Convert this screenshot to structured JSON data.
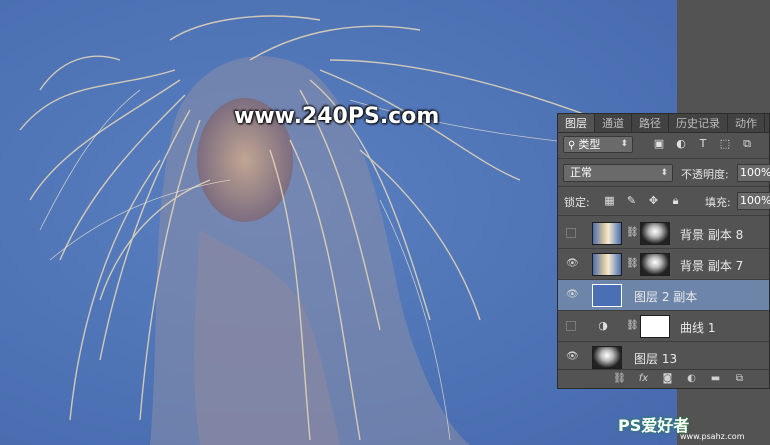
{
  "watermark": "www.240PS.com",
  "panel": {
    "tabs": [
      "图层",
      "通道",
      "路径",
      "历史记录",
      "动作"
    ],
    "filter": {
      "search_icon": "search-icon",
      "label": "类型"
    },
    "filter_icons": [
      "image-filter-icon",
      "adjustment-filter-icon",
      "type-filter-icon",
      "shape-filter-icon",
      "smart-object-filter-icon"
    ],
    "blend_mode": "正常",
    "opacity_label": "不透明度:",
    "opacity_value": "100%",
    "lock_label": "锁定:",
    "lock_icons": [
      "lock-transparent-icon",
      "lock-paint-icon",
      "lock-move-icon",
      "lock-all-icon"
    ],
    "fill_label": "填充:",
    "fill_value": "100%",
    "layers": [
      {
        "name": "背景 副本 8",
        "visible": false,
        "selected": false
      },
      {
        "name": "背景 副本 7",
        "visible": true,
        "selected": false
      },
      {
        "name": "图层 2 副本",
        "visible": true,
        "selected": true
      },
      {
        "name": "曲线 1",
        "visible": false,
        "selected": false
      },
      {
        "name": "图层 13",
        "visible": true,
        "selected": false
      }
    ],
    "bottom_icons": [
      "link-icon",
      "fx-icon",
      "mask-icon",
      "adjustment-icon",
      "folder-icon",
      "new-layer-icon"
    ]
  },
  "logo": {
    "text": "PS爱好者",
    "sub": "www.psahz.com"
  }
}
